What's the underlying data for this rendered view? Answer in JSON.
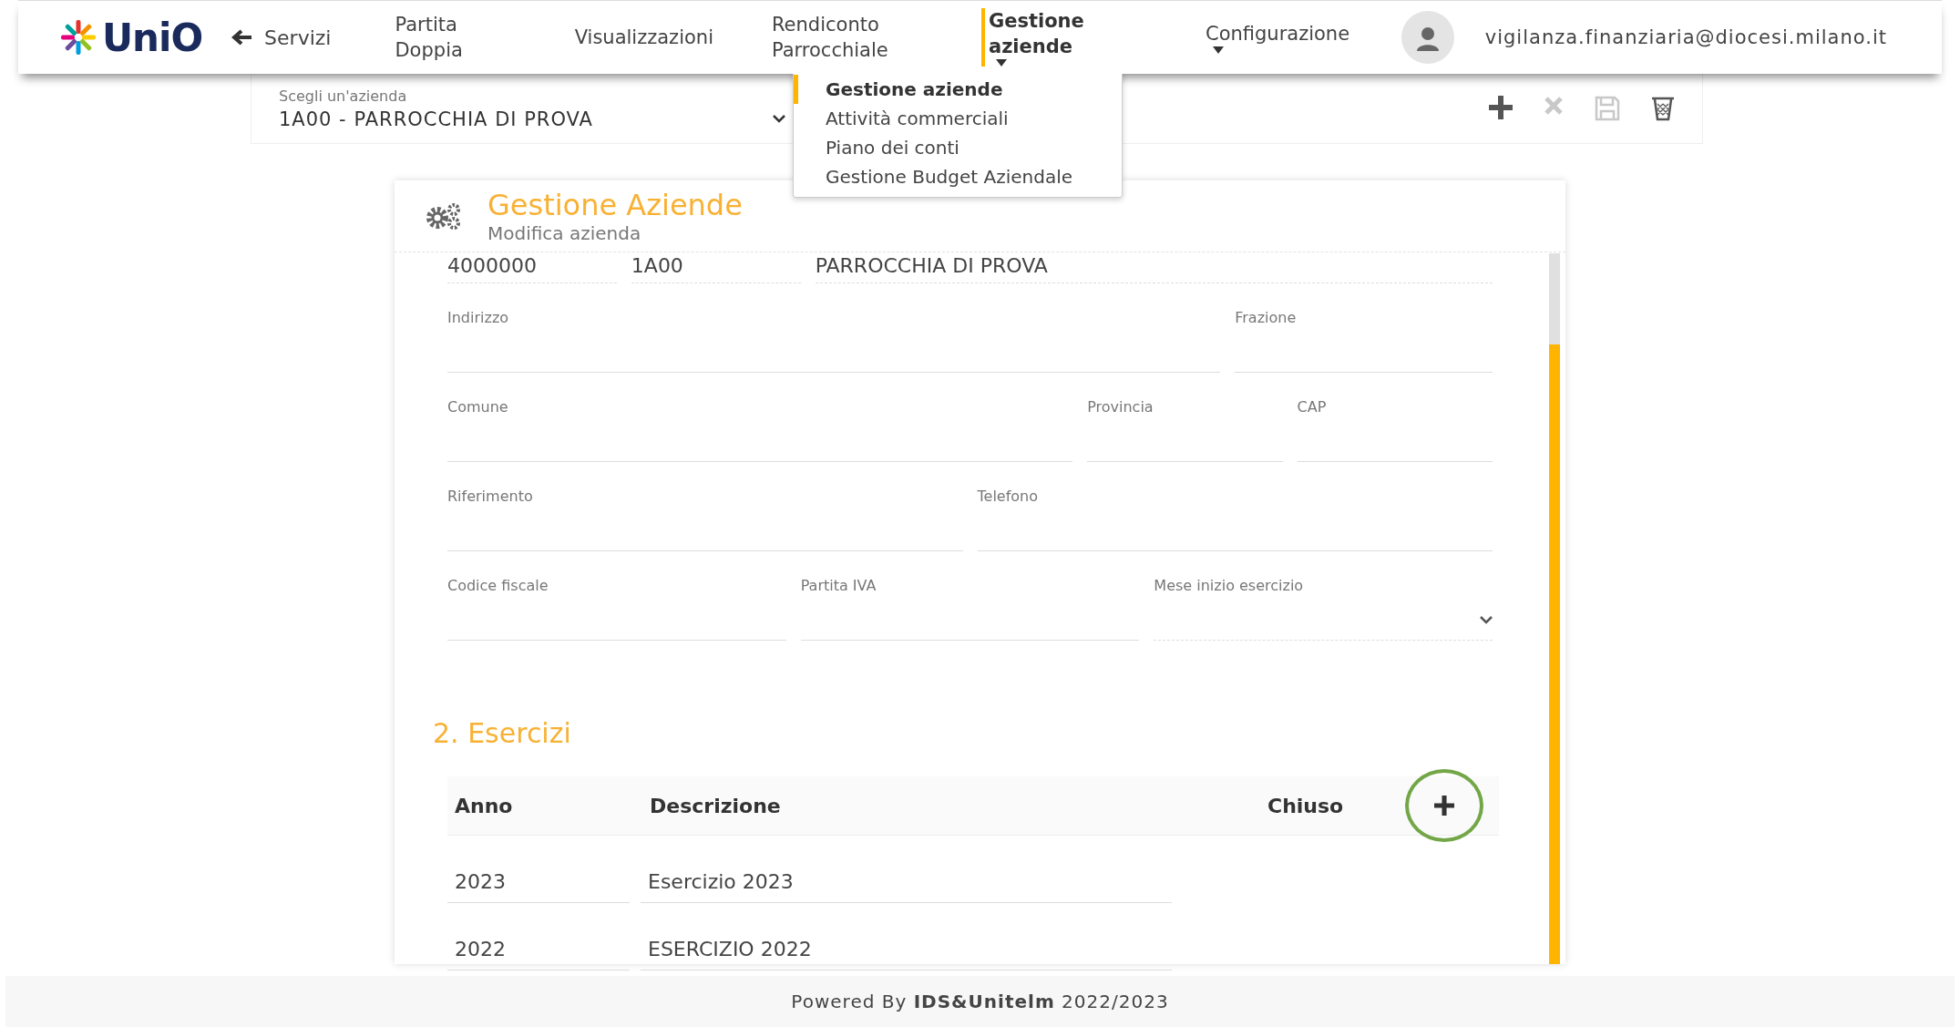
{
  "logo": {
    "text": "UniO"
  },
  "nav": {
    "back": "Servizi",
    "items": [
      {
        "label": "Partita Doppia",
        "selected": false,
        "has_menu": false
      },
      {
        "label": "Visualizzazioni",
        "selected": false,
        "has_menu": false
      },
      {
        "label": "Rendiconto Parrocchiale",
        "selected": false,
        "has_menu": false
      },
      {
        "label": "Gestione aziende",
        "selected": true,
        "has_menu": true
      },
      {
        "label": "Configurazione",
        "selected": false,
        "has_menu": true
      }
    ]
  },
  "user": {
    "email": "vigilanza.finanziaria@diocesi.milano.it"
  },
  "company_select": {
    "label": "Scegli un'azienda",
    "value": "1A00 - PARROCCHIA DI PROVA"
  },
  "toolbar": [
    {
      "kind": "add",
      "disabled": false
    },
    {
      "kind": "cancel",
      "disabled": true
    },
    {
      "kind": "save",
      "disabled": true
    },
    {
      "kind": "delete",
      "disabled": false
    }
  ],
  "menu": {
    "items": [
      {
        "label": "Gestione aziende",
        "selected": true
      },
      {
        "label": "Attività commerciali",
        "selected": false
      },
      {
        "label": "Piano dei conti",
        "selected": false
      },
      {
        "label": "Gestione Budget Aziendale",
        "selected": false
      }
    ]
  },
  "card": {
    "title": "Gestione Aziende",
    "subtitle": "Modifica azienda",
    "top_fields": [
      {
        "value": "4000000"
      },
      {
        "value": "1A00"
      },
      {
        "value": "PARROCCHIA DI PROVA"
      }
    ],
    "field_rows": [
      [
        {
          "label": "Indirizzo",
          "kind": "text"
        },
        {
          "label": "Frazione",
          "kind": "text"
        }
      ],
      [
        {
          "label": "Comune",
          "kind": "text"
        },
        {
          "label": "Provincia",
          "kind": "text"
        },
        {
          "label": "CAP",
          "kind": "text"
        }
      ],
      [
        {
          "label": "Riferimento",
          "kind": "text"
        },
        {
          "label": "Telefono",
          "kind": "text"
        }
      ],
      [
        {
          "label": "Codice fiscale",
          "kind": "text"
        },
        {
          "label": "Partita IVA",
          "kind": "text"
        },
        {
          "label": "Mese inizio esercizio",
          "kind": "select"
        }
      ]
    ],
    "section_title": "2. Esercizi",
    "table": {
      "columns": [
        "Anno",
        "Descrizione",
        "Chiuso"
      ],
      "rows": [
        [
          "2023",
          "Esercizio 2023"
        ],
        [
          "2022",
          "ESERCIZIO 2022"
        ]
      ]
    }
  },
  "footer": {
    "text": "Powered By **IDS&Unitelm** 2022/2023"
  }
}
